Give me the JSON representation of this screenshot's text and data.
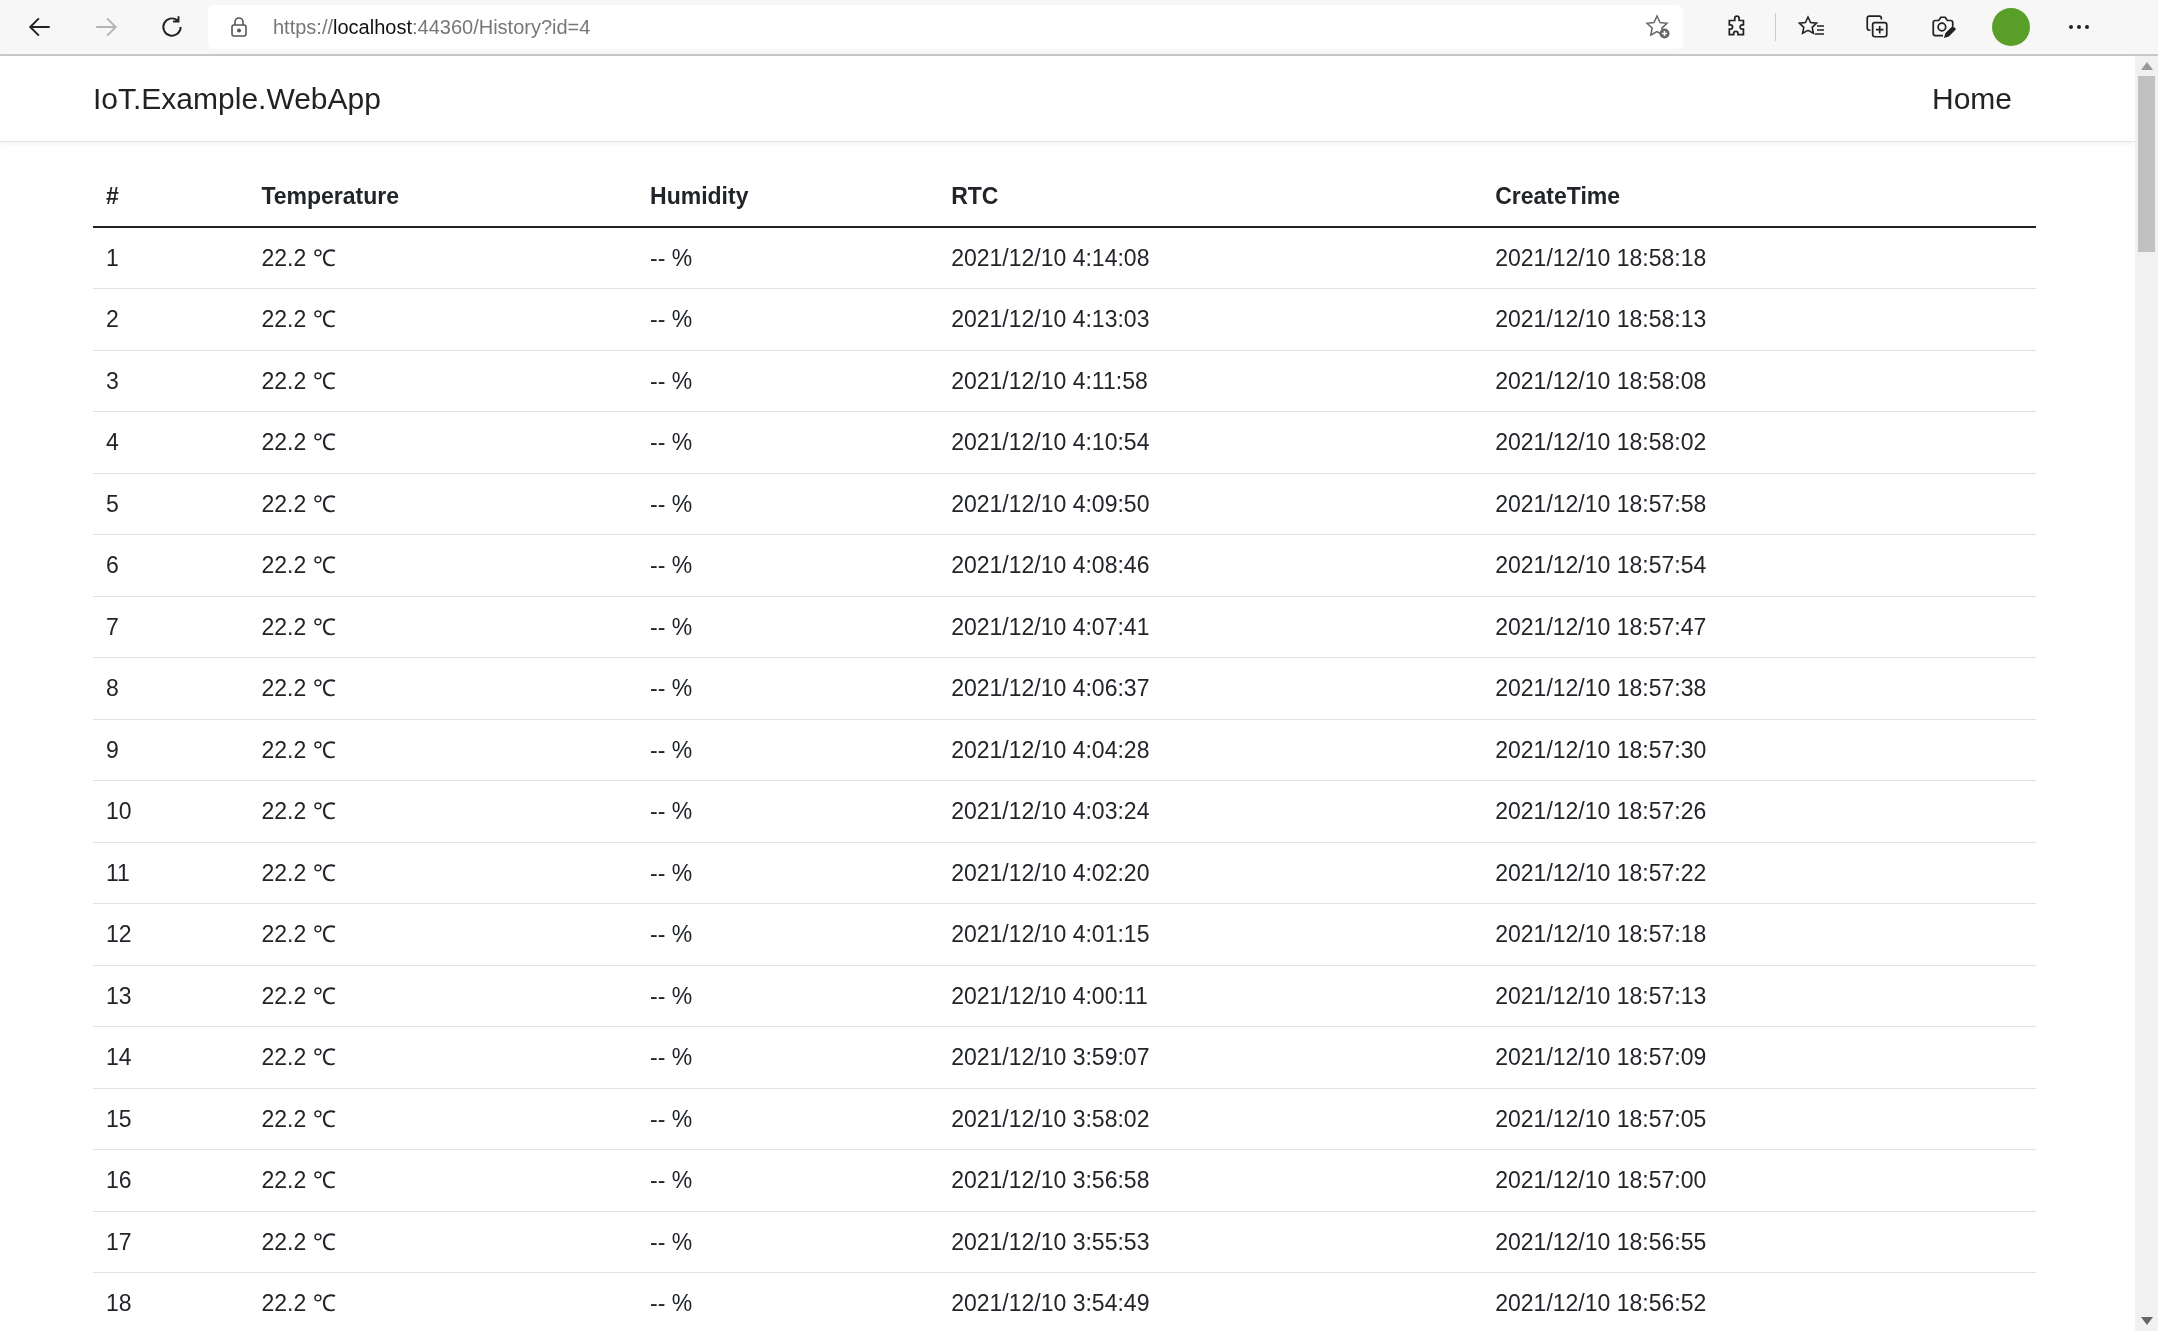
{
  "browser": {
    "url": {
      "scheme": "https://",
      "host": "localhost",
      "rest": ":44360/History?id=4"
    }
  },
  "navbar": {
    "brand": "IoT.Example.WebApp",
    "links": [
      "Home"
    ]
  },
  "table": {
    "columns": [
      "#",
      "Temperature",
      "Humidity",
      "RTC",
      "CreateTime"
    ],
    "rows": [
      [
        "1",
        "22.2 ℃",
        "-- %",
        "2021/12/10 4:14:08",
        "2021/12/10 18:58:18"
      ],
      [
        "2",
        "22.2 ℃",
        "-- %",
        "2021/12/10 4:13:03",
        "2021/12/10 18:58:13"
      ],
      [
        "3",
        "22.2 ℃",
        "-- %",
        "2021/12/10 4:11:58",
        "2021/12/10 18:58:08"
      ],
      [
        "4",
        "22.2 ℃",
        "-- %",
        "2021/12/10 4:10:54",
        "2021/12/10 18:58:02"
      ],
      [
        "5",
        "22.2 ℃",
        "-- %",
        "2021/12/10 4:09:50",
        "2021/12/10 18:57:58"
      ],
      [
        "6",
        "22.2 ℃",
        "-- %",
        "2021/12/10 4:08:46",
        "2021/12/10 18:57:54"
      ],
      [
        "7",
        "22.2 ℃",
        "-- %",
        "2021/12/10 4:07:41",
        "2021/12/10 18:57:47"
      ],
      [
        "8",
        "22.2 ℃",
        "-- %",
        "2021/12/10 4:06:37",
        "2021/12/10 18:57:38"
      ],
      [
        "9",
        "22.2 ℃",
        "-- %",
        "2021/12/10 4:04:28",
        "2021/12/10 18:57:30"
      ],
      [
        "10",
        "22.2 ℃",
        "-- %",
        "2021/12/10 4:03:24",
        "2021/12/10 18:57:26"
      ],
      [
        "11",
        "22.2 ℃",
        "-- %",
        "2021/12/10 4:02:20",
        "2021/12/10 18:57:22"
      ],
      [
        "12",
        "22.2 ℃",
        "-- %",
        "2021/12/10 4:01:15",
        "2021/12/10 18:57:18"
      ],
      [
        "13",
        "22.2 ℃",
        "-- %",
        "2021/12/10 4:00:11",
        "2021/12/10 18:57:13"
      ],
      [
        "14",
        "22.2 ℃",
        "-- %",
        "2021/12/10 3:59:07",
        "2021/12/10 18:57:09"
      ],
      [
        "15",
        "22.2 ℃",
        "-- %",
        "2021/12/10 3:58:02",
        "2021/12/10 18:57:05"
      ],
      [
        "16",
        "22.2 ℃",
        "-- %",
        "2021/12/10 3:56:58",
        "2021/12/10 18:57:00"
      ],
      [
        "17",
        "22.2 ℃",
        "-- %",
        "2021/12/10 3:55:53",
        "2021/12/10 18:56:55"
      ],
      [
        "18",
        "22.2 ℃",
        "-- %",
        "2021/12/10 3:54:49",
        "2021/12/10 18:56:52"
      ]
    ]
  }
}
